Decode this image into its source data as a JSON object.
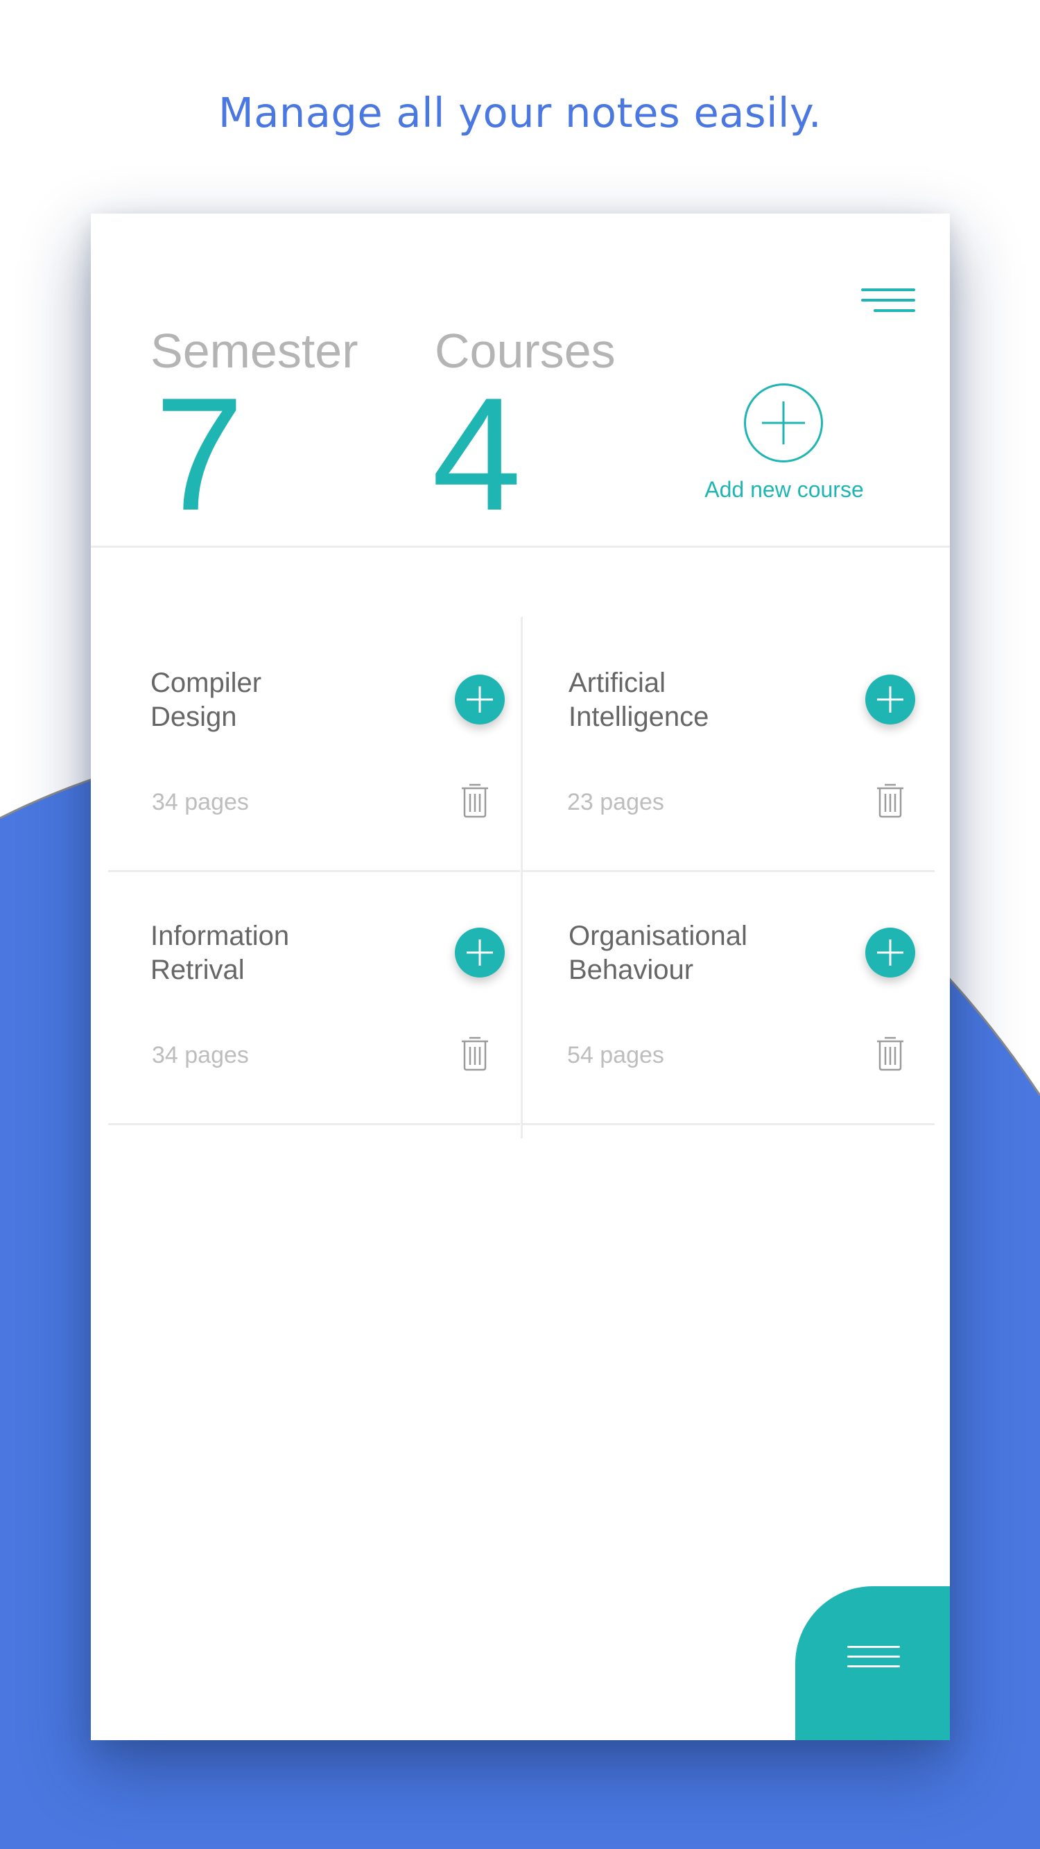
{
  "tagline": "Manage all your notes easily.",
  "colors": {
    "accent": "#1fb5b3",
    "background_wave": "#4a78e0",
    "tagline": "#4a78e0"
  },
  "header": {
    "semester_label": "Semester",
    "semester_value": "7",
    "courses_label": "Courses",
    "courses_value": "4",
    "add_course_label": "Add new course",
    "menu_icon": "hamburger-menu-icon"
  },
  "courses": [
    {
      "name": "Compiler\nDesign",
      "pages": "34 pages"
    },
    {
      "name": "Artificial\nIntelligence",
      "pages": "23 pages"
    },
    {
      "name": "Information\nRetrival",
      "pages": "34 pages"
    },
    {
      "name": "Organisational\nBehaviour",
      "pages": "54 pages"
    }
  ],
  "fab": {
    "icon": "hamburger-menu-icon"
  }
}
